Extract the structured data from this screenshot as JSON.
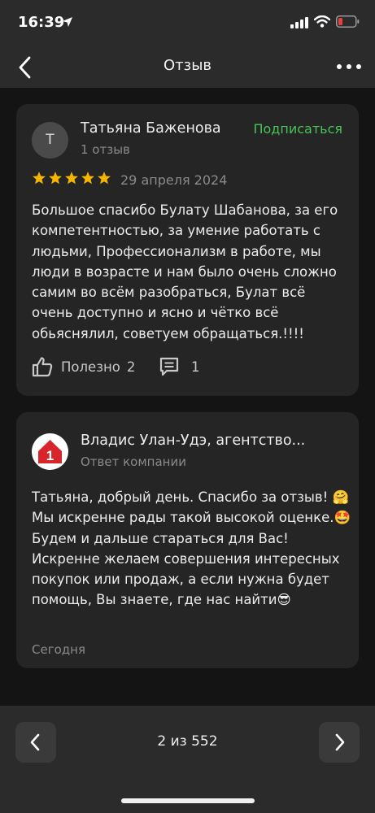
{
  "status_bar": {
    "time": "16:39"
  },
  "nav": {
    "title": "Отзыв"
  },
  "review": {
    "avatar_letter": "Т",
    "author": "Татьяна Баженова",
    "author_sub": "1 отзыв",
    "subscribe_label": "Подписаться",
    "rating": 5,
    "date": "29 апреля 2024",
    "text": "Большое спасибо Булату Шабанова, за его компетентностью, за умение работать с людьми, Профессионализм в работе, мы люди в возрасте и нам было очень сложно самим во всём разобраться, Булат всё очень доступно и ясно и чётко всё обьяснялил, советуем обращаться.!!!!",
    "helpful_label": "Полезно",
    "helpful_count": "2",
    "comments_count": "1"
  },
  "reply": {
    "logo_digit": "1",
    "company": "Владис Улан-Удэ, агентство...",
    "company_sub": "Ответ компании",
    "text": "Татьяна, добрый день. Спасибо за отзыв! 🤗 Мы искренне рады такой высокой оценке.🤩 Будем и дальше стараться для Вас! Искренне желаем совершения интересных покупок или продаж, а если нужна будет помощь, Вы знаете, где нас найти😎",
    "date": "Сегодня"
  },
  "pager": {
    "label": "2 из 552"
  },
  "colors": {
    "accent": "#47c35a",
    "star": "#f6b600",
    "logo_red": "#d6262c"
  }
}
